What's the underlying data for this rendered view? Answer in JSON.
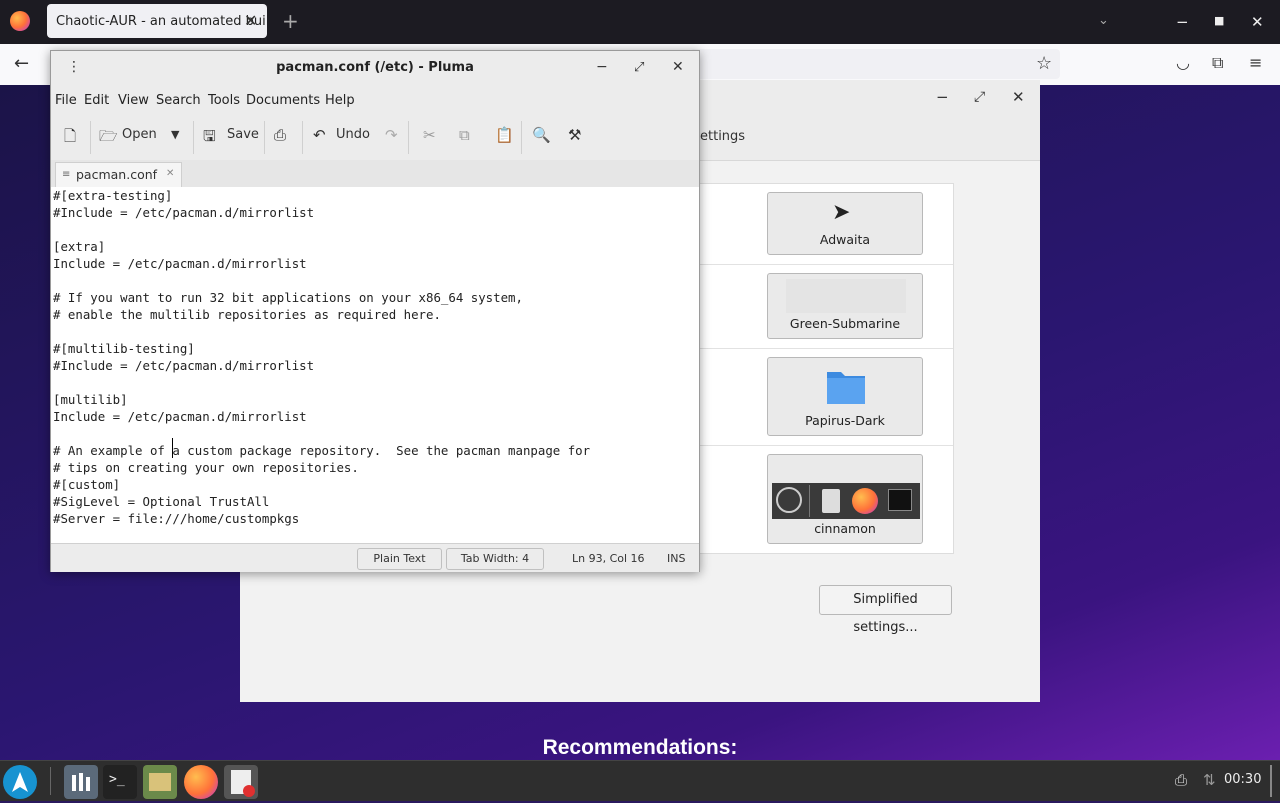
{
  "browser": {
    "tab_title": "Chaotic-AUR - an automated building repo for AUR packages",
    "tab_close": "✕",
    "new_tab": "+",
    "window_controls": {
      "minimize": "−",
      "maximize": "■",
      "close": "✕"
    }
  },
  "themes_window": {
    "tab_text": "ettings",
    "themes": [
      {
        "label": "Adwaita"
      },
      {
        "label": "Green-Submarine"
      },
      {
        "label": "Papirus-Dark"
      },
      {
        "label": "cinnamon"
      }
    ],
    "simplified_button": "Simplified settings..."
  },
  "desktop": {
    "recommendations": "Recommendations:"
  },
  "pluma": {
    "title": "pacman.conf (/etc) - Pluma",
    "menu": [
      "File",
      "Edit",
      "View",
      "Search",
      "Tools",
      "Documents",
      "Help"
    ],
    "toolbar": {
      "open": "Open",
      "save": "Save",
      "undo": "Undo"
    },
    "doc_tab": "pacman.conf",
    "lines": [
      "#[extra-testing]",
      "#Include = /etc/pacman.d/mirrorlist",
      "",
      "[extra]",
      "Include = /etc/pacman.d/mirrorlist",
      "",
      "# If you want to run 32 bit applications on your x86_64 system,",
      "# enable the multilib repositories as required here.",
      "",
      "#[multilib-testing]",
      "#Include = /etc/pacman.d/mirrorlist",
      "",
      "[multilib]",
      "Include = /etc/pacman.d/mirrorlist",
      "",
      "# An example of a custom package repository.  See the pacman manpage for",
      "# tips on creating your own repositories.",
      "#[custom]",
      "#SigLevel = Optional TrustAll",
      "#Server = file:///home/custompkgs"
    ],
    "status": {
      "syntax": "Plain Text",
      "tab_width": "Tab Width:  4",
      "position": "Ln 93, Col 16",
      "mode": "INS"
    }
  },
  "taskbar": {
    "clock": "00:30"
  },
  "colors": {
    "accent": "#4a90d9",
    "folder": "#3d8be0"
  }
}
